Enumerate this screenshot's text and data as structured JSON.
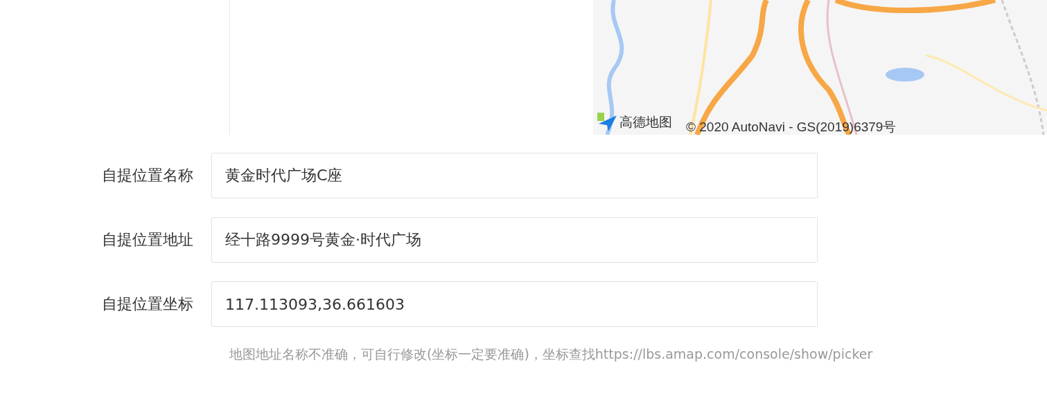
{
  "map": {
    "kind": "picture",
    "logo": "高德地图",
    "attribution": "© 2020 AutoNavi - GS(2019)6379号"
  },
  "fields": [
    {
      "label": "自提位置名称",
      "value": "黄金时代广场C座"
    },
    {
      "label": "自提位置地址",
      "value": "经十路9999号黄金·时代广场"
    },
    {
      "label": "自提位置坐标",
      "value": "117.113093,36.661603"
    }
  ],
  "hint": "地图地址名称不准确，可自行修改(坐标一定要准确)，坐标查找https://lbs.amap.com/console/show/picker"
}
